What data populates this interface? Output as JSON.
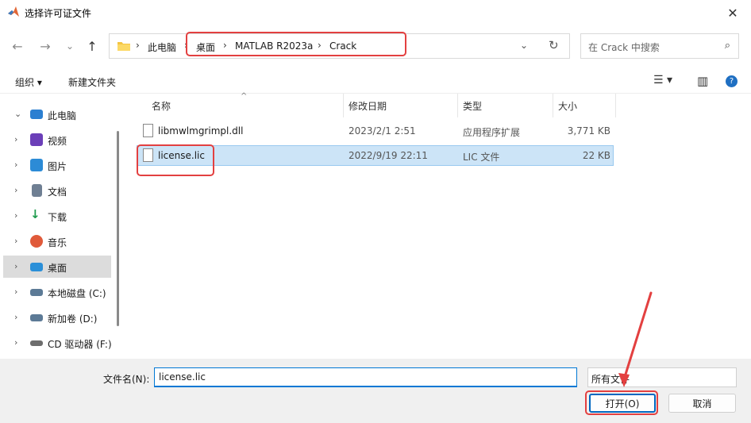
{
  "window": {
    "title": "选择许可证文件",
    "close_glyph": "✕"
  },
  "nav": {
    "back_glyph": "←",
    "forward_glyph": "→",
    "history_glyph": "⌄",
    "up_glyph": "↑",
    "breadcrumb": [
      "此电脑",
      "桌面",
      "MATLAB R2023a",
      "Crack"
    ],
    "separator": "›",
    "dropdown_glyph": "⌄",
    "refresh_glyph": "↻",
    "search_placeholder": "在 Crack 中搜索",
    "search_glyph": "⌕"
  },
  "toolbar": {
    "organize": "组织 ▾",
    "new_folder": "新建文件夹",
    "view_glyph": "☰ ▾",
    "preview_glyph": "▥",
    "help_glyph": "?"
  },
  "sidebar": {
    "items": [
      {
        "label": "此电脑",
        "chev": "⌄",
        "icon": "computer-icon",
        "color": "#2b7fd1"
      },
      {
        "label": "视频",
        "chev": "›",
        "icon": "video-icon",
        "color": "#6b3fb8"
      },
      {
        "label": "图片",
        "chev": "›",
        "icon": "pictures-icon",
        "color": "#2c8bd6"
      },
      {
        "label": "文档",
        "chev": "›",
        "icon": "documents-icon",
        "color": "#6f7f93"
      },
      {
        "label": "下载",
        "chev": "›",
        "icon": "download-icon",
        "color": "#1f9b4d"
      },
      {
        "label": "音乐",
        "chev": "›",
        "icon": "music-icon",
        "color": "#e05a3a"
      },
      {
        "label": "桌面",
        "chev": "›",
        "icon": "desktop-icon",
        "color": "#2a8fd8"
      },
      {
        "label": "本地磁盘 (C:)",
        "chev": "›",
        "icon": "drive-c-icon",
        "color": "#5c7a96"
      },
      {
        "label": "新加卷 (D:)",
        "chev": "›",
        "icon": "drive-d-icon",
        "color": "#5c7a96"
      },
      {
        "label": "CD 驱动器 (F:)",
        "chev": "›",
        "icon": "cd-drive-icon",
        "color": "#6d6d6d"
      }
    ]
  },
  "files": {
    "columns": [
      "名称",
      "修改日期",
      "类型",
      "大小"
    ],
    "sort_glyph": "^",
    "rows": [
      {
        "name": "libmwlmgrimpl.dll",
        "date": "2023/2/1 2:51",
        "type": "应用程序扩展",
        "size": "3,771 KB"
      },
      {
        "name": "license.lic",
        "date": "2022/9/19 22:11",
        "type": "LIC 文件",
        "size": "22 KB"
      }
    ]
  },
  "footer": {
    "filename_label": "文件名(N):",
    "filename_value": "license.lic",
    "filetype_value": "所有文件",
    "open_label": "打开(O)",
    "cancel_label": "取消"
  },
  "colors": {
    "accent": "#0067c0",
    "annotation": "#e34040",
    "selection": "#cce4f7"
  }
}
